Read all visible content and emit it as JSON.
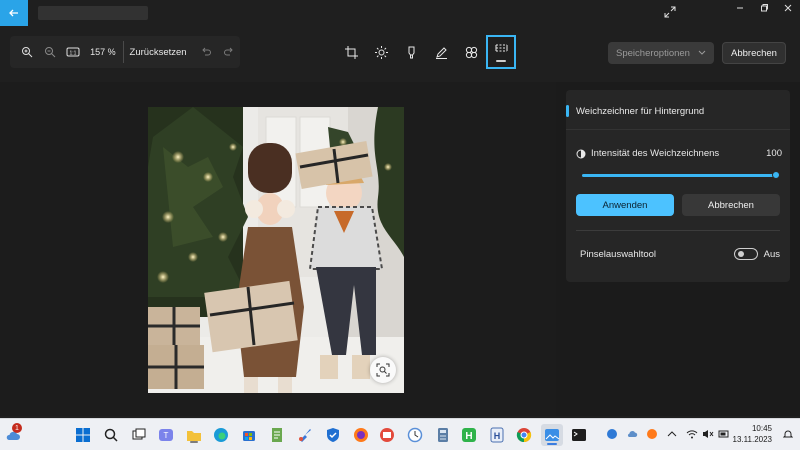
{
  "titlebar": {
    "back_icon": "arrow-left-icon",
    "expand_icon": "expand-icon",
    "window_controls": [
      "minimize-icon",
      "restore-icon",
      "close-icon"
    ]
  },
  "zoombar": {
    "zoom_in_icon": "zoom-in-icon",
    "zoom_out_icon": "zoom-out-icon",
    "actual_size_icon": "actual-size-icon",
    "actual_size_label": "1:1",
    "zoom_value": "157 %",
    "reset_label": "Zurücksetzen",
    "undo_icon": "undo-icon",
    "redo_icon": "redo-icon"
  },
  "tools": [
    {
      "name": "crop-tool",
      "icon": "crop-icon"
    },
    {
      "name": "adjust-tool",
      "icon": "brightness-icon"
    },
    {
      "name": "markup-tool",
      "icon": "marker-icon"
    },
    {
      "name": "draw-tool",
      "icon": "pen-icon"
    },
    {
      "name": "filter-tool",
      "icon": "filter-icon"
    },
    {
      "name": "background-blur-tool",
      "icon": "background-blur-icon",
      "active": true
    }
  ],
  "actions": {
    "save_options_label": "Speicheroptionen",
    "cancel_label": "Abbrechen"
  },
  "panel": {
    "title": "Weichzeichner für Hintergrund",
    "intensity_label": "Intensität des Weichzeichnens",
    "intensity_value": "100",
    "intensity_level": 1.0,
    "apply_label": "Anwenden",
    "cancel_label": "Abbrechen",
    "brush_label": "Pinselauswahltool",
    "brush_state": "Aus"
  },
  "colors": {
    "accent": "#3ab6f4",
    "apply_button": "#4cc2ff",
    "background": "#1f1f1f",
    "panel": "#262626"
  },
  "taskbar": {
    "notification_count": "1",
    "apps": [
      "weather-icon",
      "windows-start-icon",
      "search-icon",
      "task-view-icon",
      "teams-icon",
      "file-explorer-icon",
      "edge-icon",
      "store-icon",
      "notepad-icon",
      "paint-icon",
      "defender-icon",
      "firefox-icon",
      "mail-icon",
      "clock-icon",
      "calculator-icon",
      "h-app-icon",
      "h-app-2-icon",
      "chrome-icon",
      "photos-icon",
      "terminal-icon"
    ],
    "tray": [
      "security-icon",
      "cloud-icon",
      "app-tray-icon",
      "chevron-up-icon",
      "wifi-icon",
      "volume-icon",
      "battery-icon"
    ],
    "time": "10:45",
    "date": "13.11.2023"
  }
}
